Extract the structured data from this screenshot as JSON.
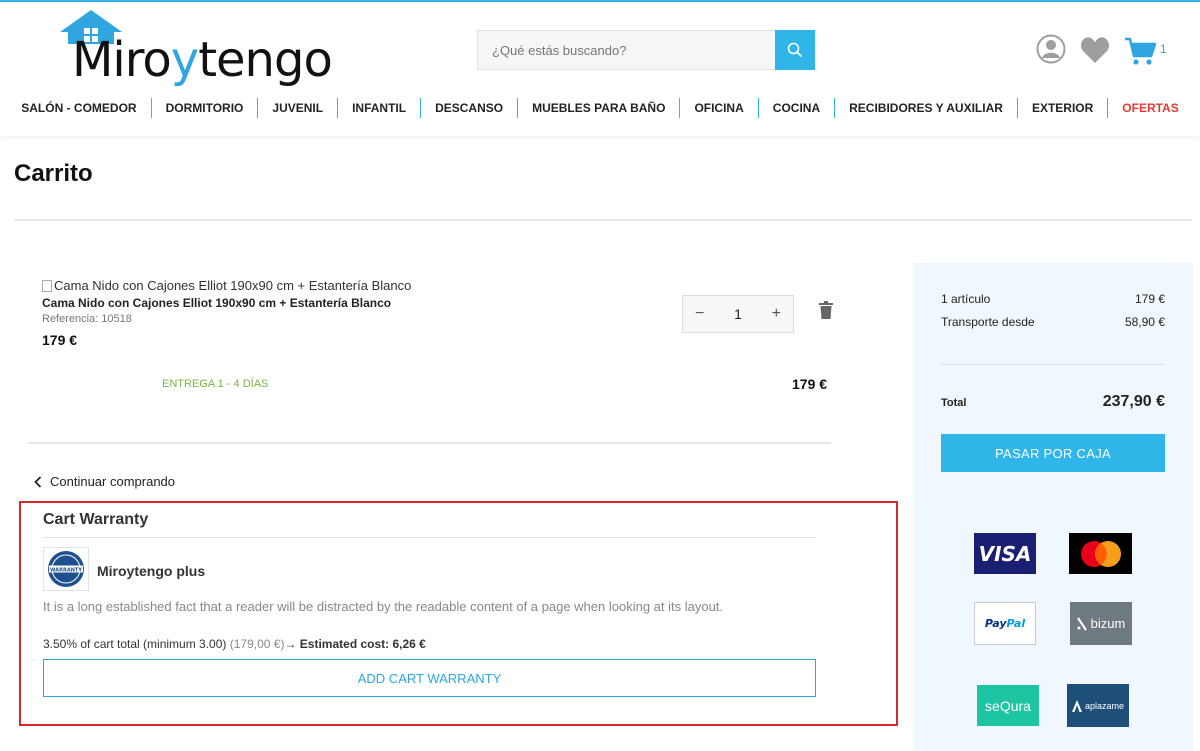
{
  "header": {
    "logo_text_a": "Miro",
    "logo_text_y": "y",
    "logo_text_b": "tengo",
    "search_placeholder": "¿Qué estás buscando?",
    "cart_count": "1"
  },
  "nav": [
    "SALÓN - COMEDOR",
    "DORMITORIO",
    "JUVENIL",
    "INFANTIL",
    "DESCANSO",
    "MUEBLES PARA BAÑO",
    "OFICINA",
    "COCINA",
    "RECIBIDORES Y AUXILIAR",
    "EXTERIOR",
    "OFERTAS"
  ],
  "page_title": "Carrito",
  "product": {
    "img_alt": "Cama Nido con Cajones Elliot 190x90 cm + Estantería Blanco",
    "name": "Cama Nido con Cajones Elliot 190x90 cm + Estantería Blanco",
    "reference": "Referencia: 10518",
    "price": "179 €",
    "delivery": "ENTREGA 1 - 4 DÍAS",
    "quantity": "1",
    "qty_minus": "−",
    "qty_plus": "+",
    "line_total": "179 €"
  },
  "continue_label": "Continuar comprando",
  "warranty": {
    "title": "Cart Warranty",
    "badge_text": "WARRANTY",
    "name": "Miroytengo plus",
    "description": "It is a long established fact that a reader will be distracted by the readable content of a page when looking at its layout.",
    "cost_text": "3.50% of cart total (minimum 3.00)",
    "cost_base": "(179,00 €)",
    "arrow": "→",
    "estimated": "Estimated cost: 6,26 €",
    "button": "ADD CART WARRANTY"
  },
  "summary": {
    "items_label": "1 artículo",
    "items_value": "179 €",
    "shipping_label": "Transporte desde",
    "shipping_value": "58,90 €",
    "total_label": "Total",
    "total_value": "237,90 €",
    "checkout": "PASAR POR CAJA"
  },
  "payments": {
    "visa": "VISA",
    "paypal_a": "Pay",
    "paypal_b": "Pal",
    "bizum": "bizum",
    "sequra": "seQura",
    "aplazame": "aplazame"
  },
  "colors": {
    "accent": "#2fb5e8",
    "offers": "#e53935",
    "delivery": "#7cb342",
    "warranty_border": "#d82a2a"
  }
}
